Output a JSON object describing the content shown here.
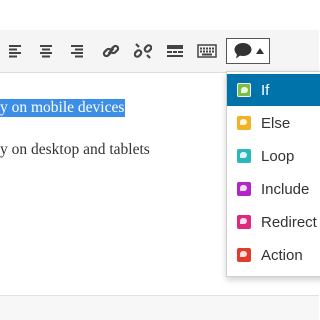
{
  "toolbar": {
    "buttons": [
      {
        "name": "align-left-icon"
      },
      {
        "name": "align-center-icon"
      },
      {
        "name": "align-right-icon"
      },
      {
        "name": "insert-link-icon"
      },
      {
        "name": "remove-link-icon"
      },
      {
        "name": "read-more-icon"
      },
      {
        "name": "keyboard-icon"
      },
      {
        "name": "shortcode-bubble-icon"
      }
    ]
  },
  "editor": {
    "line1_selected": "y on mobile devices",
    "line2": "y on desktop and tablets"
  },
  "dropdown": {
    "items": [
      {
        "label": "If",
        "icon": "if-icon",
        "color": "#7ac143"
      },
      {
        "label": "Else",
        "icon": "else-icon",
        "color": "#f0b323"
      },
      {
        "label": "Loop",
        "icon": "loop-icon",
        "color": "#2ab7bd"
      },
      {
        "label": "Include",
        "icon": "include-icon",
        "color": "#b226c8"
      },
      {
        "label": "Redirect",
        "icon": "redirect-icon",
        "color": "#e0287d"
      },
      {
        "label": "Action",
        "icon": "action-icon",
        "color": "#e13c2c"
      }
    ],
    "highlighted_index": 0,
    "highlight_color": "#0073aa"
  },
  "colors": {
    "selection": "#3d8ee6",
    "toolbar_bg": "#f5f5f5"
  }
}
